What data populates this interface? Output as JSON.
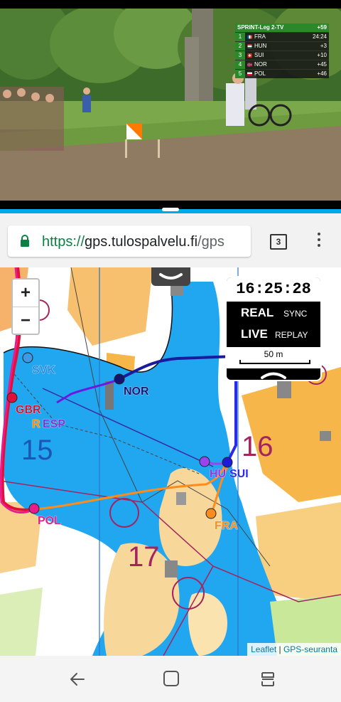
{
  "video": {
    "leaderboard": {
      "title": "SPRINT-Leg 2-TV",
      "lead_gap": "+59",
      "rows": [
        {
          "rank": "1",
          "team": "FRA",
          "time": "24:24",
          "flag": [
            "#0055a4",
            "#ffffff",
            "#ef4135"
          ]
        },
        {
          "rank": "2",
          "team": "HUN",
          "time": "+3",
          "flag": [
            "#cd2a3e",
            "#ffffff",
            "#436f4d"
          ]
        },
        {
          "rank": "3",
          "team": "SUI",
          "time": "+10",
          "flag": [
            "#d52b1e",
            "#d52b1e",
            "#d52b1e"
          ]
        },
        {
          "rank": "4",
          "team": "NOR",
          "time": "+45",
          "flag": [
            "#ba0c2f",
            "#00205b",
            "#ba0c2f"
          ]
        },
        {
          "rank": "5",
          "team": "POL",
          "time": "+46",
          "flag": [
            "#ffffff",
            "#ffffff",
            "#dc143c"
          ]
        }
      ]
    }
  },
  "browser": {
    "url_scheme": "https://",
    "url_host": "gps.tulospalvelu.fi",
    "url_path": "/gps",
    "tab_count": "3",
    "lock_icon": "lock-icon",
    "menu_icon": "more-vert-icon"
  },
  "map": {
    "zoom_in": "+",
    "zoom_out": "−",
    "clock": "16:25:28",
    "real": "REAL",
    "sync": "SYNC",
    "live": "LIVE",
    "replay": "REPLAY",
    "scale": "50 m",
    "controls": [
      "15",
      "16",
      "17"
    ],
    "attribution": {
      "leaflet": "Leaflet",
      "separator": " | ",
      "gps": "GPS-seuranta"
    },
    "teams": [
      {
        "name": "SVK",
        "color": "#2b8bd8",
        "dot": "#3b9be8",
        "label_color": "#2b8bd8"
      },
      {
        "name": "NOR",
        "color": "#1a1a9e",
        "dot": "#141470",
        "label_color": "#141470"
      },
      {
        "name": "GBR",
        "color": "#e0103a",
        "dot": "#e0103a",
        "label_color": "#d0102a"
      },
      {
        "name": "R",
        "color": "#ff8c00",
        "dot": "#ff8c00",
        "label_color": "#ff8c00"
      },
      {
        "name": "ESP",
        "color": "#7a2ee0",
        "dot": "#7a2ee0",
        "label_color": "#7a2ee0"
      },
      {
        "name": "HU",
        "color": "#8b33e6",
        "dot": "#9a44ee",
        "label_color": "#8b33e6"
      },
      {
        "name": "SUI",
        "color": "#2a2aee",
        "dot": "#1c1cd8",
        "label_color": "#2a2aee"
      },
      {
        "name": "POL",
        "color": "#e61e8c",
        "dot": "#e61e8c",
        "label_color": "#e61e8c"
      },
      {
        "name": "FRA",
        "color": "#ff8c1a",
        "dot": "#ff8c1a",
        "label_color": "#ff8c1a"
      }
    ]
  },
  "navbar": {
    "back_icon": "back-icon",
    "home_icon": "home-icon",
    "recents_icon": "recents-icon"
  }
}
